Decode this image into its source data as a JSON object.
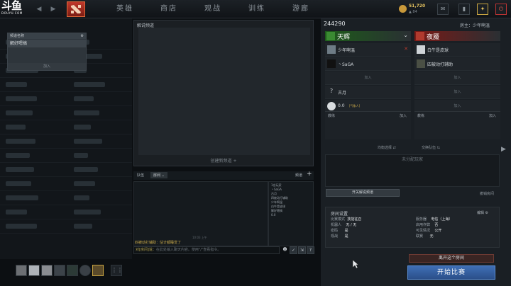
{
  "watermark": {
    "logo": "斗鱼",
    "sub": "DOUYU.COM"
  },
  "nav": {
    "tabs": [
      "英雄",
      "商店",
      "观战",
      "训练",
      "游廊"
    ]
  },
  "currency": {
    "amount": "51,720",
    "sub": "▲ 84"
  },
  "channel_panel": {
    "title": "解说频道",
    "list_header": "频道名称",
    "channel_name": "解好嗯搞",
    "join_label": "加入",
    "create_label": "创建新频道"
  },
  "chat": {
    "tab_team": "队伍",
    "tab_room": "房间",
    "tab_settings": "频道",
    "users": [
      "1名玩家",
      "丶SaGA",
      "古月",
      "四被动打辅助",
      "少年啊温",
      "白牛是皮球",
      "解好嗯搞",
      "0.0"
    ],
    "time": "10:03 上午",
    "message": "四被动打辅助：估计都睡觉了",
    "input_prefix": "对[房间]说：",
    "input_placeholder": "在此处输入聊天内容。使用\"/\"查看指令。"
  },
  "lobby": {
    "id": "244290",
    "host": "房主：少年啊温",
    "radiant": {
      "name": "天辉",
      "slots": [
        "少年啊温",
        "丶SaGA",
        "",
        "古月",
        "0.0"
      ],
      "coach_label": "教练",
      "add_label": "加入"
    },
    "dire": {
      "name": "夜魇",
      "slots": [
        "白牛是皮球",
        "四被动打辅助",
        "",
        "",
        ""
      ],
      "coach_label": "教练",
      "add_label": "加入"
    },
    "join_label": "加入",
    "newbie_tag": "[气象人]",
    "shuffle_label": "均衡选择",
    "swap_label": "交换队伍",
    "unassigned_label": "未分配玩家",
    "toggle_channel_label": "开关解说频道",
    "cancel_label": "撤销房间",
    "settings": {
      "title": "房间设置",
      "edit": "编辑",
      "mode_key": "比赛模式",
      "mode_val": "技能征召",
      "server_key": "服务器",
      "server_val": "电信（上海）",
      "bots_key": "机器人",
      "bots_val": "无 / 无",
      "cheats_key": "启用作弊",
      "cheats_val": "否",
      "password_key": "密码",
      "password_val": "是",
      "visibility_key": "可见情况",
      "visibility_val": "公开",
      "spectate_key": "观战",
      "spectate_val": "是",
      "league_key": "联赛",
      "league_val": "无"
    },
    "leave_label": "离开这个房间",
    "start_label": "开始比赛"
  }
}
